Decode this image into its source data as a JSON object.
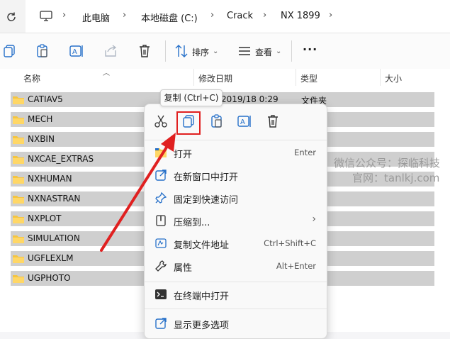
{
  "address": {
    "crumbs": [
      "此电脑",
      "本地磁盘 (C:)",
      "Crack",
      "NX 1899"
    ]
  },
  "toolbar": {
    "sort_label": "排序",
    "view_label": "查看",
    "more_label": "···"
  },
  "columns": {
    "name": "名称",
    "date": "修改日期",
    "type": "类型",
    "size": "大小"
  },
  "files": [
    {
      "name": "CATIAV5",
      "date": "2019/18 0:29",
      "type": "文件夹"
    },
    {
      "name": "MECH",
      "date": "",
      "type": ""
    },
    {
      "name": "NXBIN",
      "date": "",
      "type": ""
    },
    {
      "name": "NXCAE_EXTRAS",
      "date": "",
      "type": ""
    },
    {
      "name": "NXHUMAN",
      "date": "",
      "type": ""
    },
    {
      "name": "NXNASTRAN",
      "date": "",
      "type": ""
    },
    {
      "name": "NXPLOT",
      "date": "",
      "type": ""
    },
    {
      "name": "SIMULATION",
      "date": "",
      "type": ""
    },
    {
      "name": "UGFLEXLM",
      "date": "",
      "type": ""
    },
    {
      "name": "UGPHOTO",
      "date": "",
      "type": ""
    }
  ],
  "tooltip": "复制 (Ctrl+C)",
  "context_menu": {
    "items": [
      {
        "label": "打开",
        "shortcut": "Enter",
        "icon": "folder-open-icon"
      },
      {
        "label": "在新窗口中打开",
        "shortcut": "",
        "icon": "new-window-icon"
      },
      {
        "label": "固定到快速访问",
        "shortcut": "",
        "icon": "pin-icon"
      },
      {
        "label": "压缩到...",
        "shortcut": "›",
        "icon": "zip-icon"
      },
      {
        "label": "复制文件地址",
        "shortcut": "Ctrl+Shift+C",
        "icon": "copy-path-icon"
      },
      {
        "label": "属性",
        "shortcut": "Alt+Enter",
        "icon": "wrench-icon"
      },
      {
        "label": "在终端中打开",
        "shortcut": "",
        "icon": "terminal-icon"
      },
      {
        "label": "显示更多选项",
        "shortcut": "",
        "icon": "more-options-icon"
      }
    ]
  },
  "watermark": {
    "line1": "微信公众号：探临科技",
    "line2": "官网：tanlkj.com"
  },
  "colors": {
    "accent": "#2670c9",
    "highlight_box": "#e02020",
    "arrow": "#e02020",
    "row_selected": "#cfcfcf"
  }
}
